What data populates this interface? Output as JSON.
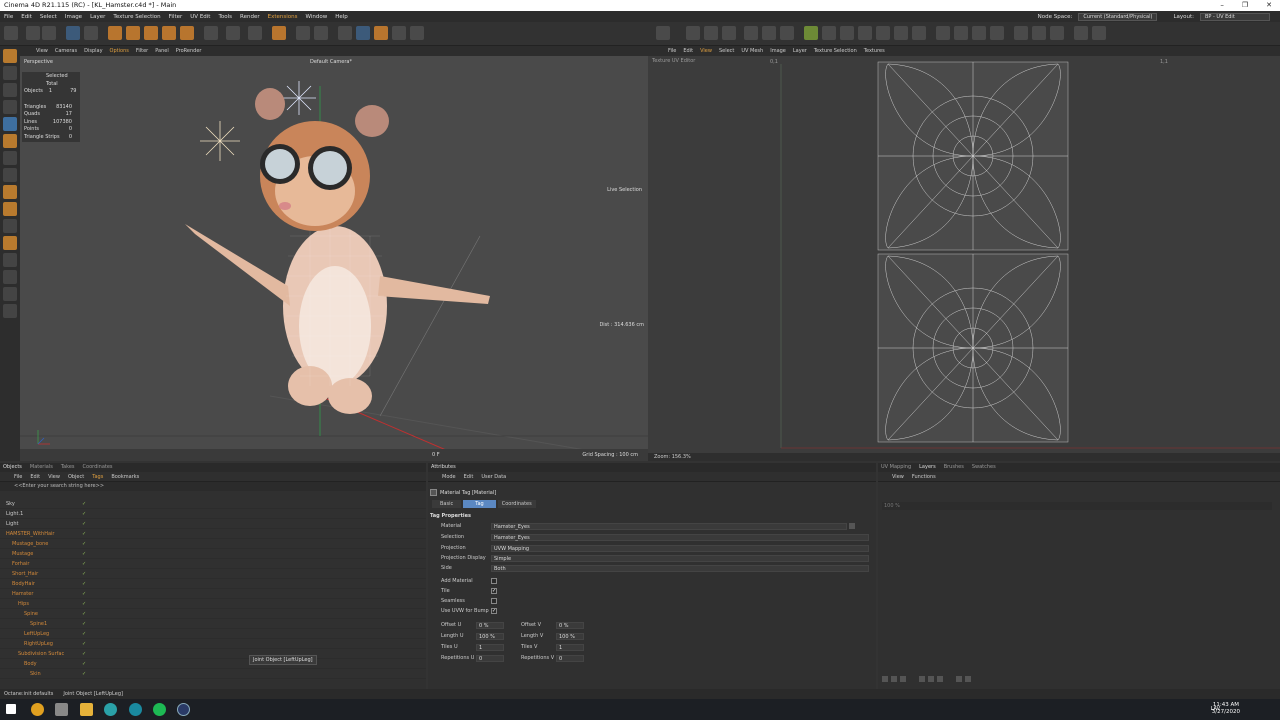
{
  "window": {
    "title": "Cinema 4D R21.115 (RC) - [KL_Hamster.c4d *] - Main"
  },
  "menubar": {
    "items": [
      "File",
      "Edit",
      "Select",
      "Image",
      "Layer",
      "Texture Selection",
      "Filter",
      "UV Edit",
      "Tools",
      "Render",
      "Extensions",
      "Window",
      "Help"
    ],
    "node_space_label": "Node Space:",
    "node_space_value": "Current (Standard/Physical)",
    "layout_label": "Layout:",
    "layout_value": "BP - UV Edit"
  },
  "viewport": {
    "menu": [
      "View",
      "Cameras",
      "Display",
      "Options",
      "Filter",
      "Panel",
      "ProRender"
    ],
    "mode_label": "Perspective",
    "camera_label": "Default Camera*",
    "selected_total_header": "Selected Total",
    "objects_label": "Objects",
    "objects_selected": "1",
    "objects_total": "79",
    "stats": [
      {
        "label": "Triangles",
        "value": "83140"
      },
      {
        "label": "Quads",
        "value": "17"
      },
      {
        "label": "Lines",
        "value": "107380"
      },
      {
        "label": "Points",
        "value": "0"
      },
      {
        "label": "Triangle Strips",
        "value": "0"
      }
    ],
    "live_selection": "Live Selection",
    "dist": "Dist : 314.636 cm",
    "grid_spacing": "Grid Spacing : 100 cm",
    "frame": "0 F"
  },
  "uv": {
    "menu": [
      "File",
      "Edit",
      "View",
      "Select",
      "UV Mesh",
      "Image",
      "Layer",
      "Texture Selection",
      "Textures"
    ],
    "title": "Texture UV Editor",
    "coord_left": "0,1",
    "coord_right": "1,1",
    "zoom": "Zoom: 156.3%"
  },
  "objects_panel": {
    "tabs": [
      "Objects",
      "Materials",
      "Takes",
      "Coordinates"
    ],
    "menu": [
      "File",
      "Edit",
      "View",
      "Object",
      "Tags",
      "Bookmarks"
    ],
    "search_placeholder": "<<Enter your search string here>>",
    "rows": [
      {
        "name": "Sky",
        "orange": false,
        "indent": 6
      },
      {
        "name": "Light.1",
        "orange": false,
        "indent": 6
      },
      {
        "name": "Light",
        "orange": false,
        "indent": 6
      },
      {
        "name": "HAMSTER_WithHair",
        "orange": true,
        "indent": 6
      },
      {
        "name": "Mustage_bone",
        "orange": true,
        "indent": 12
      },
      {
        "name": "Mustage",
        "orange": true,
        "indent": 12
      },
      {
        "name": "Forhair",
        "orange": true,
        "indent": 12
      },
      {
        "name": "Short_Hair",
        "orange": true,
        "indent": 12
      },
      {
        "name": "BodyHair",
        "orange": true,
        "indent": 12
      },
      {
        "name": "Hamster",
        "orange": true,
        "indent": 12
      },
      {
        "name": "Hips",
        "orange": true,
        "indent": 18
      },
      {
        "name": "Spine",
        "orange": true,
        "indent": 24
      },
      {
        "name": "Spine1",
        "orange": true,
        "indent": 30
      },
      {
        "name": "LeftUpLeg",
        "orange": true,
        "indent": 24
      },
      {
        "name": "RightUpLeg",
        "orange": true,
        "indent": 24
      },
      {
        "name": "Subdivision Surface",
        "orange": true,
        "indent": 18
      },
      {
        "name": "Body",
        "orange": true,
        "indent": 24
      },
      {
        "name": "Skin",
        "orange": true,
        "indent": 30
      }
    ],
    "tooltip": "Joint Object [LeftUpLeg]"
  },
  "attributes": {
    "tab": "Attributes",
    "menu": [
      "Mode",
      "Edit",
      "User Data"
    ],
    "header": "Material Tag [Material]",
    "subtabs": [
      "Basic",
      "Tag",
      "Coordinates"
    ],
    "section": "Tag Properties",
    "material_label": "Material",
    "material_value": "Hamster_Eyes",
    "selection_label": "Selection",
    "selection_value": "Hamster_Eyes",
    "projection_label": "Projection",
    "projection_value": "UVW Mapping",
    "projection_display_label": "Projection Display",
    "projection_display_value": "Simple",
    "side_label": "Side",
    "side_value": "Both",
    "add_material_label": "Add Material",
    "tile_label": "Tile",
    "seamless_label": "Seamless",
    "use_uvw_label": "Use UVW for Bump",
    "offset_u_label": "Offset U",
    "offset_u_value": "0 %",
    "offset_v_label": "Offset V",
    "offset_v_value": "0 %",
    "length_u_label": "Length U",
    "length_u_value": "100 %",
    "length_v_label": "Length V",
    "length_v_value": "100 %",
    "tiles_u_label": "Tiles U",
    "tiles_u_value": "1",
    "tiles_v_label": "Tiles V",
    "tiles_v_value": "1",
    "rep_u_label": "Repetitions U",
    "rep_u_value": "0",
    "rep_v_label": "Repetitions V",
    "rep_v_value": "0"
  },
  "layers_panel": {
    "tabs": [
      "UV Mapping",
      "Layers",
      "Brushes",
      "Swatches"
    ],
    "menu": [
      "View",
      "Functions"
    ],
    "percent": "100 %"
  },
  "statusbar": {
    "left": "Octane:init defaults",
    "right": "Joint Object [LeftUpLeg]"
  },
  "taskbar": {
    "lang": "LAV",
    "time": "11:43 AM",
    "date": "3/27/2020"
  },
  "colors": {
    "accent_orange": "#d48a3a",
    "accent_blue": "#5b88c2",
    "check_green": "#8fbc5a"
  }
}
